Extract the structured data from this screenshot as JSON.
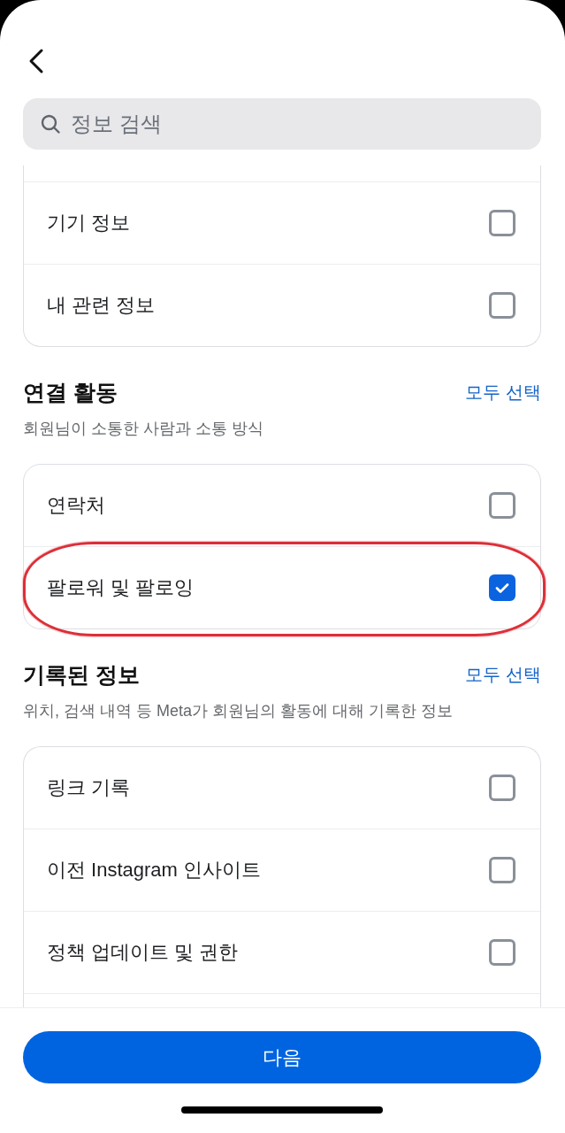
{
  "search": {
    "placeholder": "정보 검색"
  },
  "sections": [
    {
      "items": [
        {
          "label": "기기 정보",
          "checked": false,
          "highlighted": false
        },
        {
          "label": "내 관련 정보",
          "checked": false,
          "highlighted": false
        }
      ]
    },
    {
      "title": "연결 활동",
      "action": "모두 선택",
      "description": "회원님이 소통한 사람과 소통 방식",
      "items": [
        {
          "label": "연락처",
          "checked": false,
          "highlighted": false
        },
        {
          "label": "팔로워 및 팔로잉",
          "checked": true,
          "highlighted": true
        }
      ]
    },
    {
      "title": "기록된 정보",
      "action": "모두 선택",
      "description": "위치, 검색 내역 등 Meta가 회원님의 활동에 대해 기록한 정보",
      "items": [
        {
          "label": "링크 기록",
          "checked": false,
          "highlighted": false
        },
        {
          "label": "이전 Instagram 인사이트",
          "checked": false,
          "highlighted": false
        },
        {
          "label": "정책 업데이트 및 권한",
          "checked": false,
          "highlighted": false
        }
      ]
    }
  ],
  "next_button": {
    "label": "다음"
  }
}
